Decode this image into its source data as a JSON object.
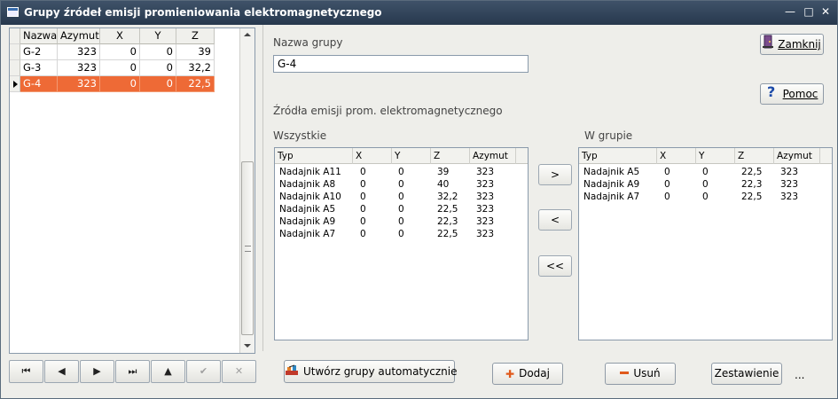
{
  "window": {
    "title": "Grupy źródeł emisji promieniowania elektromagnetycznego",
    "controls": [
      "—",
      "□",
      "✕"
    ]
  },
  "groups_grid": {
    "columns": [
      "Nazwa",
      "Azymut",
      "X",
      "Y",
      "Z"
    ],
    "rows": [
      {
        "nazwa": "G-2",
        "azymut": "323",
        "x": "0",
        "y": "0",
        "z": "39"
      },
      {
        "nazwa": "G-3",
        "azymut": "323",
        "x": "0",
        "y": "0",
        "z": "32,2"
      },
      {
        "nazwa": "G-4",
        "azymut": "323",
        "x": "0",
        "y": "0",
        "z": "22,5"
      }
    ],
    "selected_row": 2
  },
  "navigator": {
    "buttons": [
      {
        "name": "first-record-button",
        "glyph": "⏮",
        "enabled": true
      },
      {
        "name": "prior-record-button",
        "glyph": "◀",
        "enabled": true
      },
      {
        "name": "next-record-button",
        "glyph": "▶",
        "enabled": true
      },
      {
        "name": "last-record-button",
        "glyph": "⏭",
        "enabled": true
      },
      {
        "name": "insert-record-button",
        "glyph": "▲",
        "enabled": true
      },
      {
        "name": "post-record-button",
        "glyph": "✔",
        "enabled": false
      },
      {
        "name": "cancel-record-button",
        "glyph": "✕",
        "enabled": false
      }
    ]
  },
  "form": {
    "group_name_label": "Nazwa grupy",
    "group_name_value": "G-4",
    "sources_label": "Źródła emisji prom. elektromagnetycznego",
    "all_label": "Wszystkie",
    "in_group_label": "W grupie"
  },
  "buttons": {
    "close": "Zamknij",
    "help": "Pomoc",
    "auto_create": "Utwórz grupy automatycznie",
    "add": "Dodaj",
    "remove": "Usuń",
    "summary": "Zestawienie",
    "more": "...",
    "move_right": ">",
    "move_left": "<",
    "move_all_left": "<<"
  },
  "list_columns": [
    "Typ",
    "X",
    "Y",
    "Z",
    "Azymut"
  ],
  "all_sources": [
    {
      "typ": "Nadajnik A11",
      "x": "0",
      "y": "0",
      "z": "39",
      "azymut": "323"
    },
    {
      "typ": "Nadajnik A8",
      "x": "0",
      "y": "0",
      "z": "40",
      "azymut": "323"
    },
    {
      "typ": "Nadajnik A10",
      "x": "0",
      "y": "0",
      "z": "32,2",
      "azymut": "323"
    },
    {
      "typ": "Nadajnik A5",
      "x": "0",
      "y": "0",
      "z": "22,5",
      "azymut": "323"
    },
    {
      "typ": "Nadajnik A9",
      "x": "0",
      "y": "0",
      "z": "22,3",
      "azymut": "323"
    },
    {
      "typ": "Nadajnik A7",
      "x": "0",
      "y": "0",
      "z": "22,5",
      "azymut": "323"
    }
  ],
  "group_sources": [
    {
      "typ": "Nadajnik A5",
      "x": "0",
      "y": "0",
      "z": "22,5",
      "azymut": "323"
    },
    {
      "typ": "Nadajnik A9",
      "x": "0",
      "y": "0",
      "z": "22,3",
      "azymut": "323"
    },
    {
      "typ": "Nadajnik A7",
      "x": "0",
      "y": "0",
      "z": "22,5",
      "azymut": "323"
    }
  ],
  "colors": {
    "selection": "#ee6a36",
    "titlebar": "#2f4058"
  }
}
